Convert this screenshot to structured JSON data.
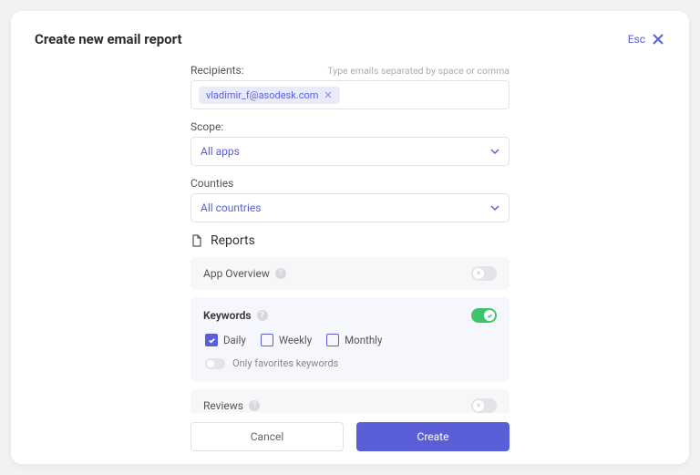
{
  "header": {
    "title": "Create new email report",
    "esc_label": "Esc"
  },
  "recipients": {
    "label": "Recipients:",
    "hint": "Type emails separated by space or comma",
    "chips": [
      "vladimir_f@asodesk.com"
    ]
  },
  "scope": {
    "label": "Scope:",
    "value": "All apps"
  },
  "countries": {
    "label": "Counties",
    "value": "All countries"
  },
  "reports": {
    "section_label": "Reports",
    "items": [
      {
        "name": "App Overview",
        "enabled": false
      },
      {
        "name": "Keywords",
        "enabled": true,
        "frequencies": [
          {
            "label": "Daily",
            "checked": true
          },
          {
            "label": "Weekly",
            "checked": false
          },
          {
            "label": "Monthly",
            "checked": false
          }
        ],
        "favorites_label": "Only favorites keywords",
        "favorites_enabled": false
      },
      {
        "name": "Reviews",
        "enabled": false
      }
    ]
  },
  "footer": {
    "cancel": "Cancel",
    "create": "Create"
  }
}
